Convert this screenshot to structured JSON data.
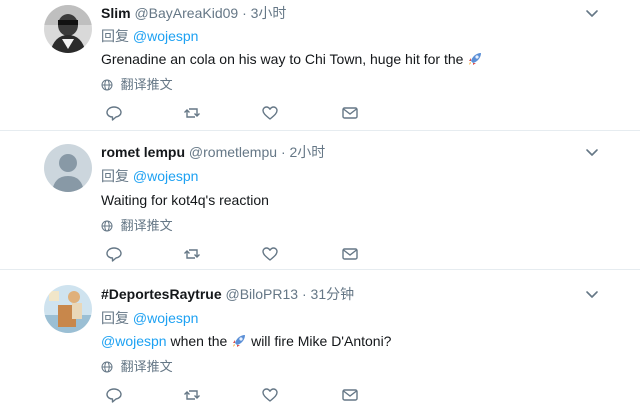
{
  "tweets": [
    {
      "name": "Slim",
      "handle": "@BayAreaKid09",
      "separator": "·",
      "time": "3小时",
      "reply_prefix": "回复",
      "reply_to": "@wojespn",
      "text": "Grenadine an cola on his way to Chi Town, huge hit for the",
      "text_after": "",
      "translate": "翻译推文",
      "emoji_icon": "rocket-icon"
    },
    {
      "name": "romet lempu",
      "handle": "@rometlempu",
      "separator": "·",
      "time": "2小时",
      "reply_prefix": "回复",
      "reply_to": "@wojespn",
      "text": "Waiting for kot4q's reaction",
      "translate": "翻译推文"
    },
    {
      "name": "#DeportesRaytrue",
      "handle": "@BiloPR13",
      "separator": "·",
      "time": "31分钟",
      "reply_prefix": "回复",
      "reply_to": "@wojespn",
      "text_mention": "@wojespn",
      "text": " when the ",
      "text_after": " will fire Mike D'Antoni?",
      "translate": "翻译推文",
      "emoji_icon": "rocket-icon"
    }
  ],
  "colors": {
    "text": "#14171a",
    "muted": "#657786",
    "link": "#1da1f2",
    "divider": "#e6ecf0"
  }
}
